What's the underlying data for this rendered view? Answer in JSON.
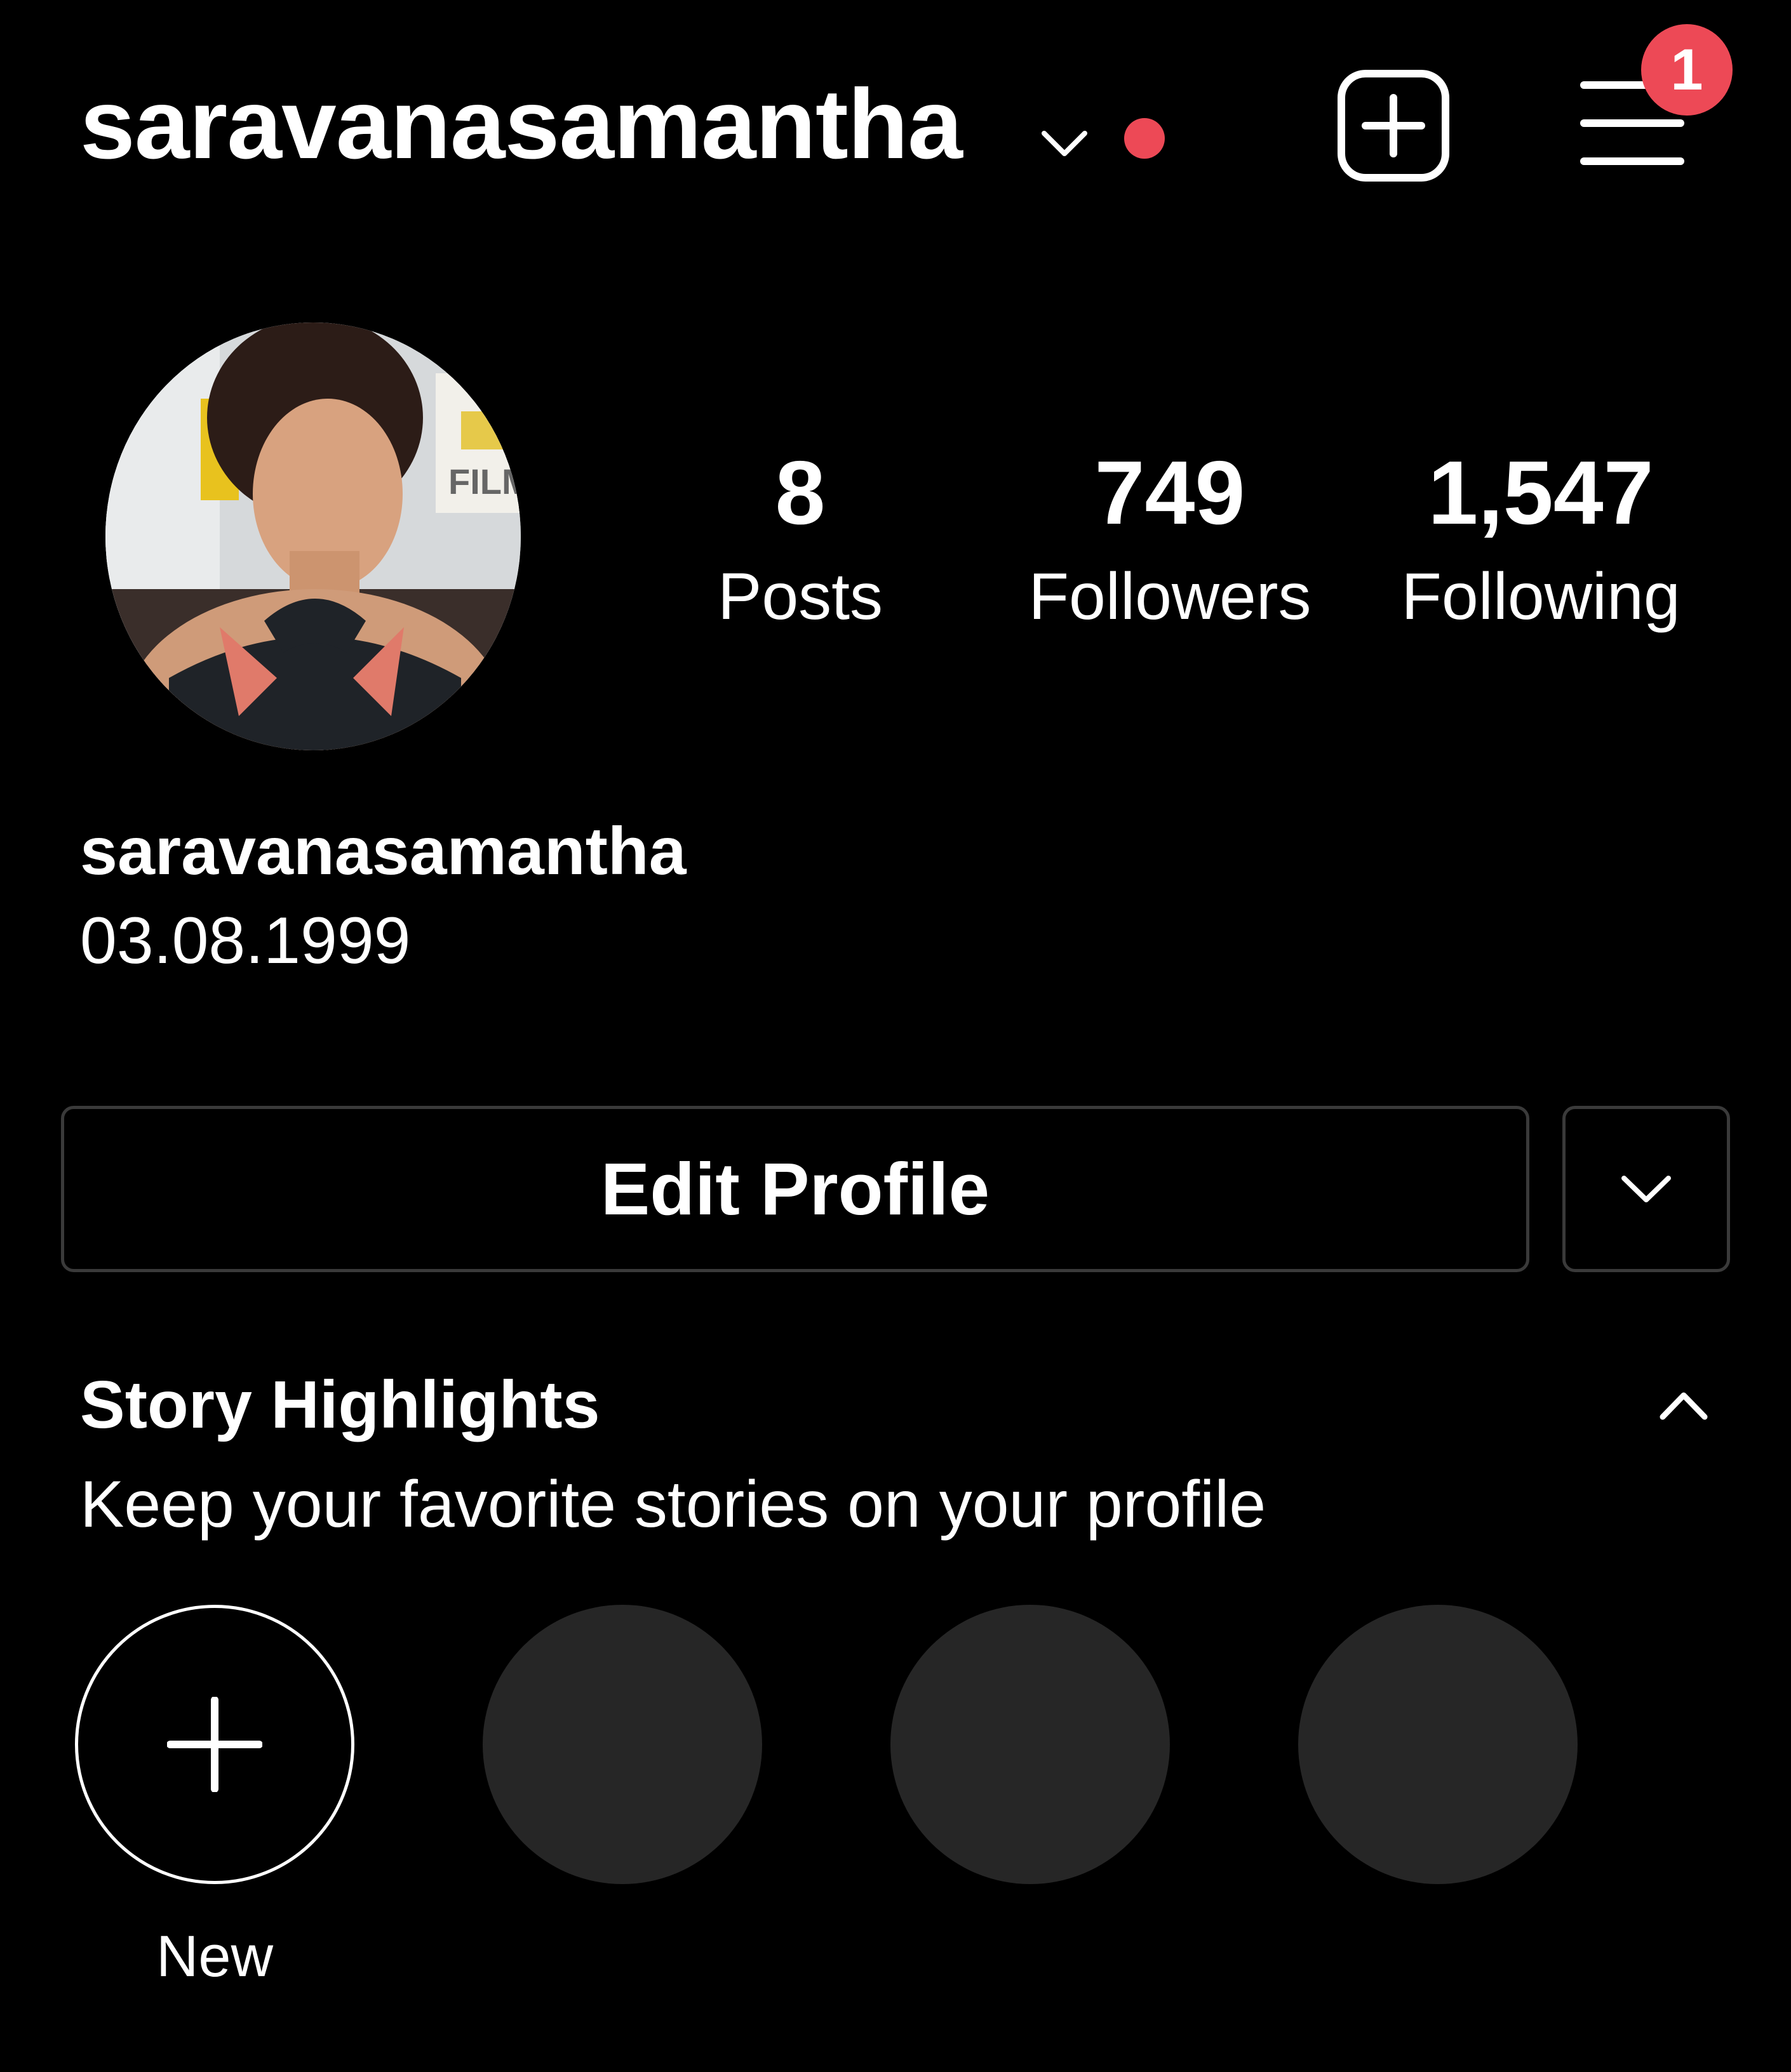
{
  "header": {
    "username": "saravanasamantha",
    "notification_count": "1"
  },
  "stats": {
    "posts": {
      "value": "8",
      "label": "Posts"
    },
    "followers": {
      "value": "749",
      "label": "Followers"
    },
    "following": {
      "value": "1,547",
      "label": "Following"
    }
  },
  "profile": {
    "name": "saravanasamantha",
    "bio": "03.08.1999"
  },
  "actions": {
    "edit_profile_label": "Edit Profile"
  },
  "highlights": {
    "title": "Story Highlights",
    "subtitle": "Keep your favorite stories on your profile",
    "new_label": "New"
  },
  "icons": {
    "account_switch": "chevron-down-icon",
    "create": "plus-square-icon",
    "menu": "hamburger-menu-icon",
    "more": "chevron-down-icon",
    "collapse": "chevron-up-icon",
    "new_highlight": "plus-icon"
  },
  "colors": {
    "background": "#000000",
    "text": "#ffffff",
    "accent_red": "#ed4956",
    "placeholder": "#262626",
    "button_border": "#3a3a3a"
  }
}
